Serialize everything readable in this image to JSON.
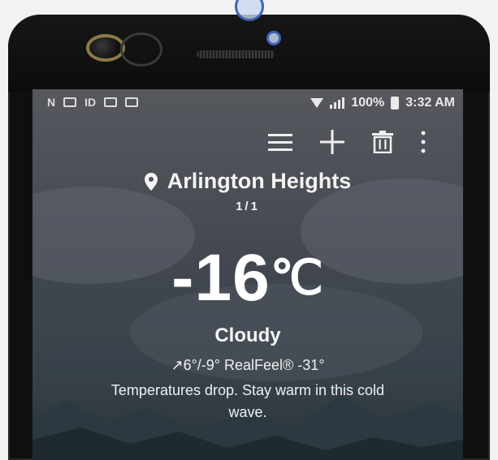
{
  "status_bar": {
    "left_icons": [
      "N",
      "ID"
    ],
    "battery": "100%",
    "time": "3:32 AM"
  },
  "toolbar": {
    "menu_icon": "hamburger-menu-icon",
    "add_icon": "plus-icon",
    "delete_icon": "trash-icon",
    "more_icon": "vertical-dots-icon"
  },
  "location": {
    "city": "Arlington Heights",
    "page_indicator": "1/1"
  },
  "weather": {
    "temperature": "-16",
    "unit": "℃",
    "condition": "Cloudy",
    "hi_lo": "6°/-9°",
    "realfeel": "RealFeel® -31°",
    "message": "Temperatures drop. Stay warm in this cold wave."
  },
  "colors": {
    "screen_top": "#56585e",
    "screen_bottom": "#2b343a",
    "touch_ring": "#3f63b8"
  }
}
